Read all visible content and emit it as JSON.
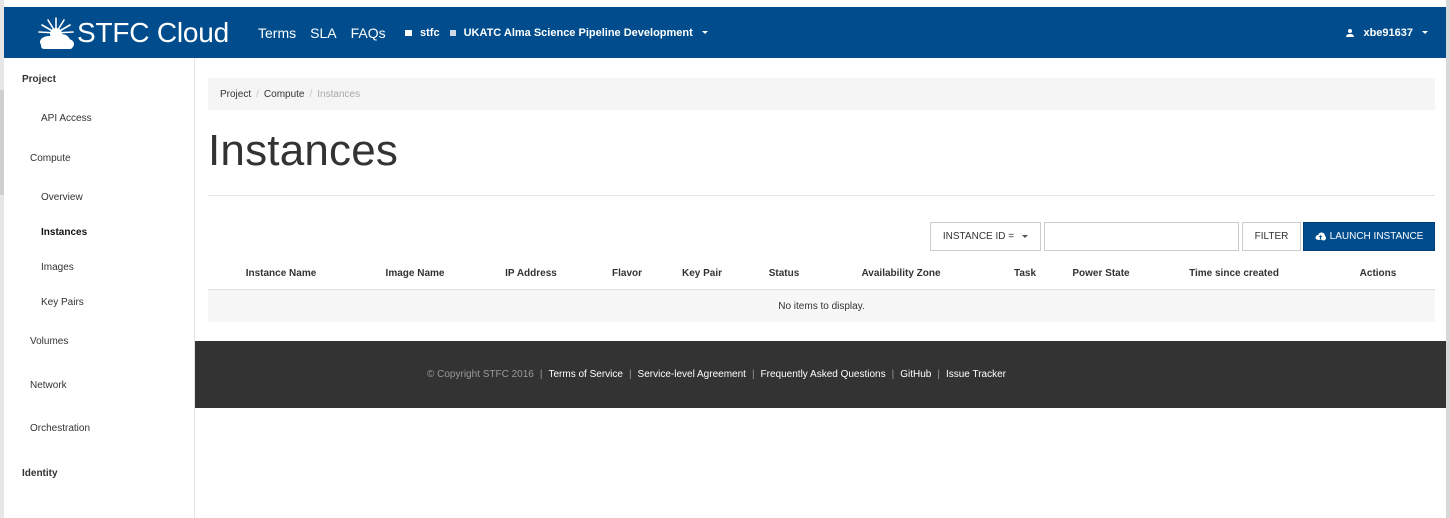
{
  "navbar": {
    "brand": "STFC Cloud",
    "links": [
      "Terms",
      "SLA",
      "FAQs"
    ],
    "domain": "stfc",
    "project": "UKATC Alma Science Pipeline Development",
    "user": "xbe91637"
  },
  "sidebar": {
    "project_header": "Project",
    "api_access": "API Access",
    "compute": "Compute",
    "overview": "Overview",
    "instances": "Instances",
    "images": "Images",
    "key_pairs": "Key Pairs",
    "volumes": "Volumes",
    "network": "Network",
    "orchestration": "Orchestration",
    "identity_header": "Identity"
  },
  "breadcrumb": [
    "Project",
    "Compute",
    "Instances"
  ],
  "page_title": "Instances",
  "toolbar": {
    "filter_field": "INSTANCE ID =",
    "filter_value": "",
    "filter_button": "FILTER",
    "launch_button": "LAUNCH INSTANCE"
  },
  "table": {
    "columns": [
      "Instance Name",
      "Image Name",
      "IP Address",
      "Flavor",
      "Key Pair",
      "Status",
      "Availability Zone",
      "Task",
      "Power State",
      "Time since created",
      "Actions"
    ],
    "empty_message": "No items to display."
  },
  "footer": {
    "copyright": "© Copyright STFC 2016",
    "links": [
      "Terms of Service",
      "Service-level Agreement",
      "Frequently Asked Questions",
      "GitHub",
      "Issue Tracker"
    ]
  },
  "colors": {
    "navbar": "#004c8c",
    "primary_button": "#004c8c",
    "footer": "#333333"
  }
}
